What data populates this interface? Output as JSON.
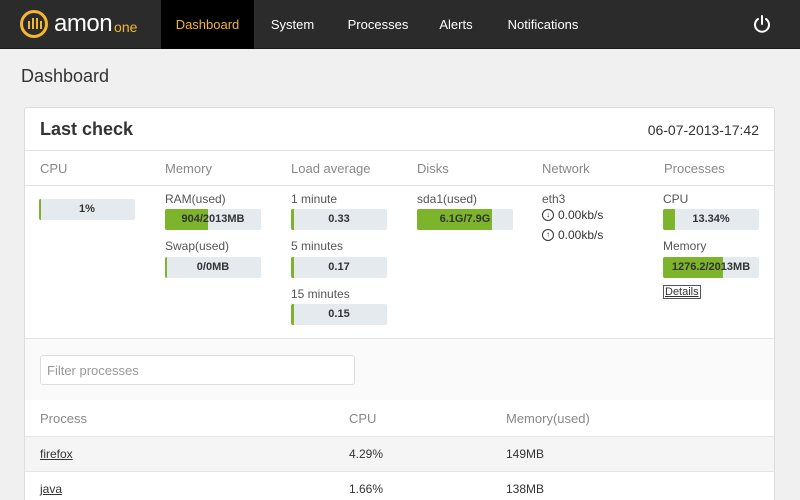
{
  "brand": {
    "name": "amon",
    "sub": "one"
  },
  "nav": {
    "items": [
      {
        "label": "Dashboard",
        "active": true
      },
      {
        "label": "System",
        "active": false
      },
      {
        "label": "Processes",
        "active": false
      },
      {
        "label": "Alerts",
        "active": false
      },
      {
        "label": "Notifications",
        "active": false
      }
    ],
    "power_icon": "power-icon"
  },
  "page": {
    "title": "Dashboard"
  },
  "last_check": {
    "title": "Last check",
    "date": "06-07-2013-17:42",
    "columns": [
      "CPU",
      "Memory",
      "Load average",
      "Disks",
      "Network",
      "Processes"
    ],
    "cpu": {
      "value": "1%",
      "fraction": 0.01
    },
    "memory": {
      "ram_label": "RAM(used)",
      "ram_value": "904/2013MB",
      "ram_fraction": 0.45,
      "swap_label": "Swap(used)",
      "swap_value": "0/0MB",
      "swap_fraction": 0.0
    },
    "load": [
      {
        "label": "1 minute",
        "value": "0.33",
        "fraction": 0.03
      },
      {
        "label": "5 minutes",
        "value": "0.17",
        "fraction": 0.03
      },
      {
        "label": "15 minutes",
        "value": "0.15",
        "fraction": 0.03
      }
    ],
    "disks": {
      "label": "sda1(used)",
      "value": "6.1G/7.9G",
      "fraction": 0.78
    },
    "network": {
      "iface": "eth3",
      "down": "0.00kb/s",
      "up": "0.00kb/s"
    },
    "processes": {
      "cpu_label": "CPU",
      "cpu_value": "13.34%",
      "cpu_fraction": 0.13,
      "mem_label": "Memory",
      "mem_value": "1276.2/2013MB",
      "mem_fraction": 0.63,
      "details_label": "Details"
    }
  },
  "filter": {
    "placeholder": "Filter processes"
  },
  "process_table": {
    "headers": [
      "Process",
      "CPU",
      "Memory(used)"
    ],
    "rows": [
      {
        "name": "firefox",
        "cpu": "4.29%",
        "memory": "149MB"
      },
      {
        "name": "java",
        "cpu": "1.66%",
        "memory": "138MB"
      }
    ]
  },
  "colors": {
    "accent": "#f2b632",
    "bar_fill": "#7cb42b",
    "bar_track": "#e5eaee",
    "topbar": "#2b2b2b"
  }
}
